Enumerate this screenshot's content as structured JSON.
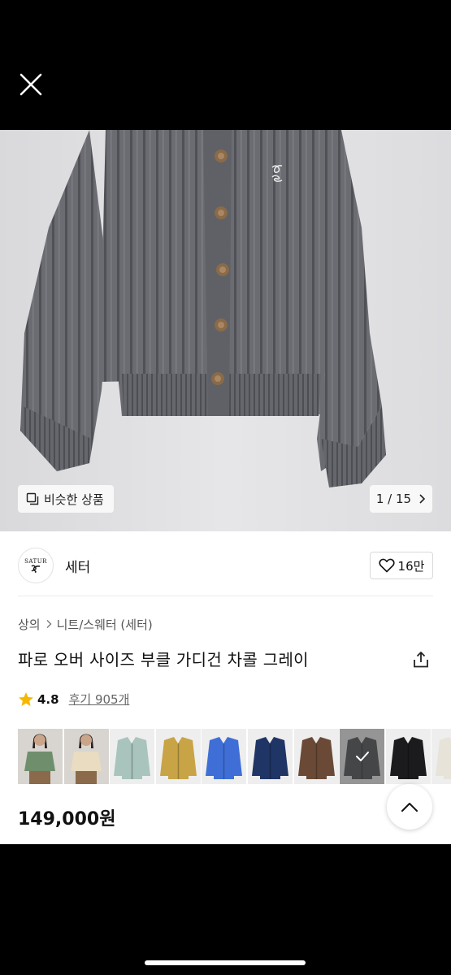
{
  "viewer": {
    "close_icon": "close-icon",
    "similar_label": "비슷한 상품",
    "similar_icon": "similar-items-icon",
    "page_indicator": "1 / 15",
    "pager_icon": "chevron-right-icon"
  },
  "shop": {
    "logo_text": "SATUR",
    "name": "세터",
    "like_count": "16만",
    "like_icon": "heart-icon"
  },
  "product": {
    "breadcrumb": [
      "상의",
      "니트/스웨터 (세터)"
    ],
    "title": "파로 오버 사이즈 부클 가디건 차콜 그레이",
    "share_icon": "share-icon",
    "rating": "4.8",
    "reviews_label": "후기 905개",
    "price": "149,000원"
  },
  "swatches": [
    {
      "name": "green",
      "color": "#6f8f6c",
      "type": "model"
    },
    {
      "name": "cream",
      "color": "#e9dcc0",
      "type": "model"
    },
    {
      "name": "mint",
      "color": "#a9c3bd",
      "type": "flat"
    },
    {
      "name": "mustard",
      "color": "#c8a446",
      "type": "flat"
    },
    {
      "name": "blue",
      "color": "#3f6fd6",
      "type": "flat"
    },
    {
      "name": "navy",
      "color": "#1f3566",
      "type": "flat"
    },
    {
      "name": "brown",
      "color": "#6a4a36",
      "type": "flat"
    },
    {
      "name": "charcoal",
      "color": "#5d5f63",
      "type": "flat",
      "selected": true
    },
    {
      "name": "black",
      "color": "#1b1b1d",
      "type": "flat"
    },
    {
      "name": "ivory",
      "color": "#e7e3d8",
      "type": "flat"
    }
  ],
  "colors": {
    "star": "#f5b800",
    "cardigan": "#6b6d72"
  }
}
